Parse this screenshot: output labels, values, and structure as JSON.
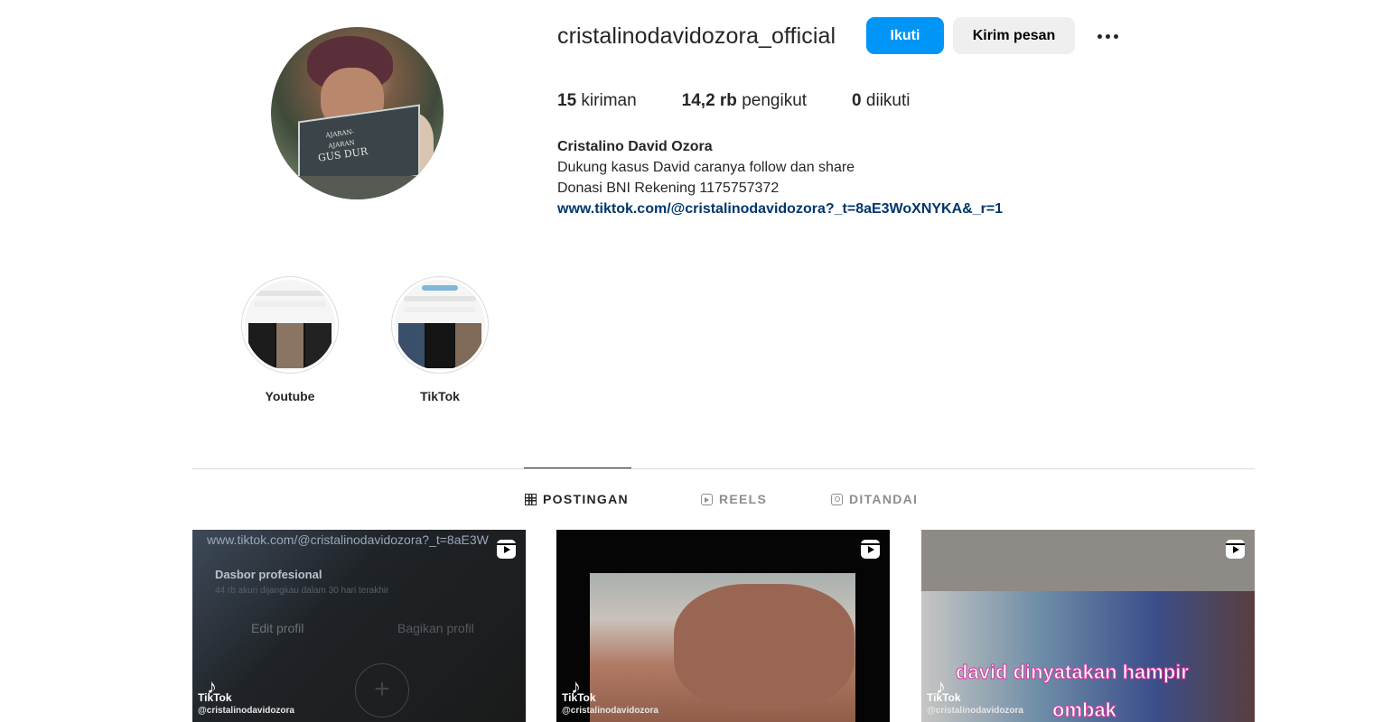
{
  "profile": {
    "username": "cristalinodavidozora_official",
    "follow_label": "Ikuti",
    "message_label": "Kirim pesan",
    "more_icon": "more-horizontal-icon"
  },
  "stats": {
    "posts_count": "15",
    "posts_label": "kiriman",
    "followers_count": "14,2 rb",
    "followers_label": "pengikut",
    "following_count": "0",
    "following_label": "diikuti"
  },
  "bio": {
    "name": "Cristalino David Ozora",
    "line1": "Dukung kasus David caranya follow dan share",
    "line2": "Donasi BNI Rekening 1175757372",
    "link": "www.tiktok.com/@cristalinodavidozora?_t=8aE3WoXNYKA&_r=1"
  },
  "avatar": {
    "book_title": "GUS DUR",
    "book_subtitle": "AJARAN-AJARAN"
  },
  "highlights": [
    {
      "label": "Youtube"
    },
    {
      "label": "TikTok"
    }
  ],
  "tabs": [
    {
      "label": "POSTINGAN",
      "icon": "grid-icon",
      "active": true
    },
    {
      "label": "REELS",
      "icon": "reels-icon",
      "active": false
    },
    {
      "label": "DITANDAI",
      "icon": "tagged-icon",
      "active": false
    }
  ],
  "posts": [
    {
      "type": "reel",
      "overlay_url": "www.tiktok.com/@cristalinodavidozora?_t=8aE3W",
      "dashboard": "Dasbor profesional",
      "dashboard_sub": "44 rb akun dijangkau dalam 30 hari terakhir",
      "edit": "Edit profil",
      "share": "Bagikan profil",
      "brand": "TikTok",
      "handle": "@cristalinodavidozora"
    },
    {
      "type": "reel",
      "brand": "TikTok",
      "handle": "@cristalinodavidozora"
    },
    {
      "type": "reel",
      "caption_line1": "david dinyatakan hampir",
      "caption_line2": "ombak",
      "brand": "TikTok",
      "handle": "@cristalinodavidozora"
    }
  ]
}
